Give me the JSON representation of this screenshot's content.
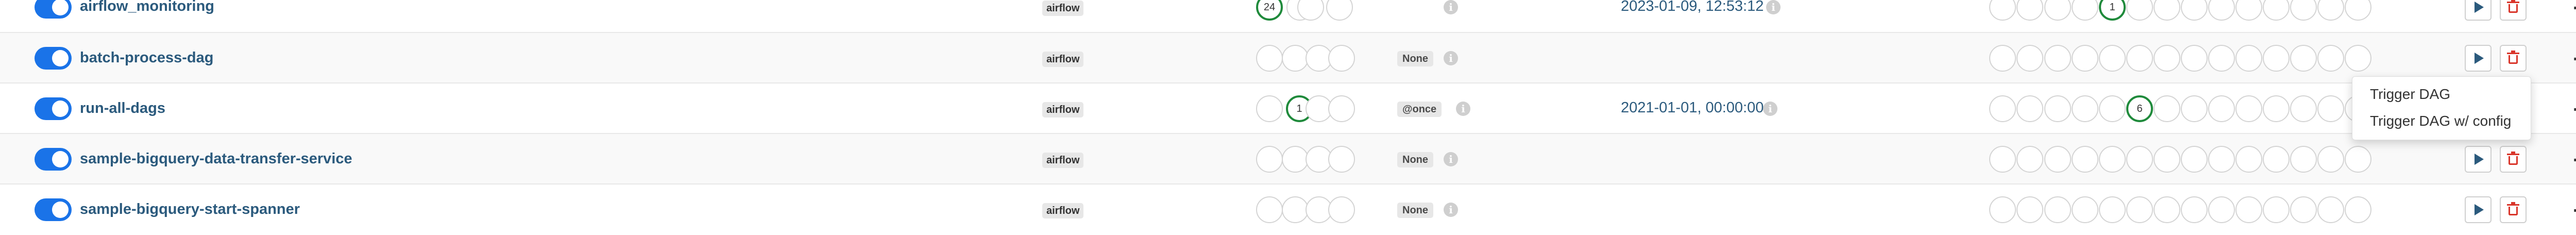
{
  "rows": [
    {
      "name": "airflow_monitoring",
      "tag": "airflow",
      "schedule": "",
      "next_run": "2023-01-09, 12:53:12",
      "runs": [
        "24",
        "",
        "",
        ""
      ],
      "tasks": [
        "",
        "",
        "",
        "",
        "1",
        "",
        "",
        "",
        "",
        "",
        "",
        "",
        "",
        ""
      ]
    },
    {
      "name": "batch-process-dag",
      "tag": "airflow",
      "schedule": "None",
      "next_run": "",
      "runs": [
        "",
        "",
        "",
        ""
      ],
      "tasks": [
        "",
        "",
        "",
        "",
        "",
        "",
        "",
        "",
        "",
        "",
        "",
        "",
        "",
        ""
      ]
    },
    {
      "name": "run-all-dags",
      "tag": "airflow",
      "schedule": "@once",
      "next_run": "2021-01-01, 00:00:00",
      "runs": [
        "",
        "1",
        "",
        ""
      ],
      "tasks": [
        "",
        "",
        "",
        "",
        "",
        "6",
        "",
        "",
        "",
        "",
        "",
        "",
        "",
        ""
      ]
    },
    {
      "name": "sample-bigquery-data-transfer-service",
      "tag": "airflow",
      "schedule": "None",
      "next_run": "",
      "runs": [
        "",
        "",
        "",
        ""
      ],
      "tasks": [
        "",
        "",
        "",
        "",
        "",
        "",
        "",
        "",
        "",
        "",
        "",
        "",
        "",
        ""
      ]
    },
    {
      "name": "sample-bigquery-start-spanner",
      "tag": "airflow",
      "schedule": "None",
      "next_run": "",
      "runs": [
        "",
        "",
        "",
        ""
      ],
      "tasks": [
        "",
        "",
        "",
        "",
        "",
        "",
        "",
        "",
        "",
        "",
        "",
        "",
        "",
        ""
      ]
    }
  ],
  "trigger_menu": {
    "items": [
      "Trigger DAG",
      "Trigger DAG w/ config"
    ]
  },
  "icons": {
    "info": "i",
    "more": "..."
  },
  "colors": {
    "toggle_on": "#1a73e8",
    "success_ring": "#1f8a3b",
    "delete": "#d9352a",
    "link": "#2b5a7d"
  }
}
